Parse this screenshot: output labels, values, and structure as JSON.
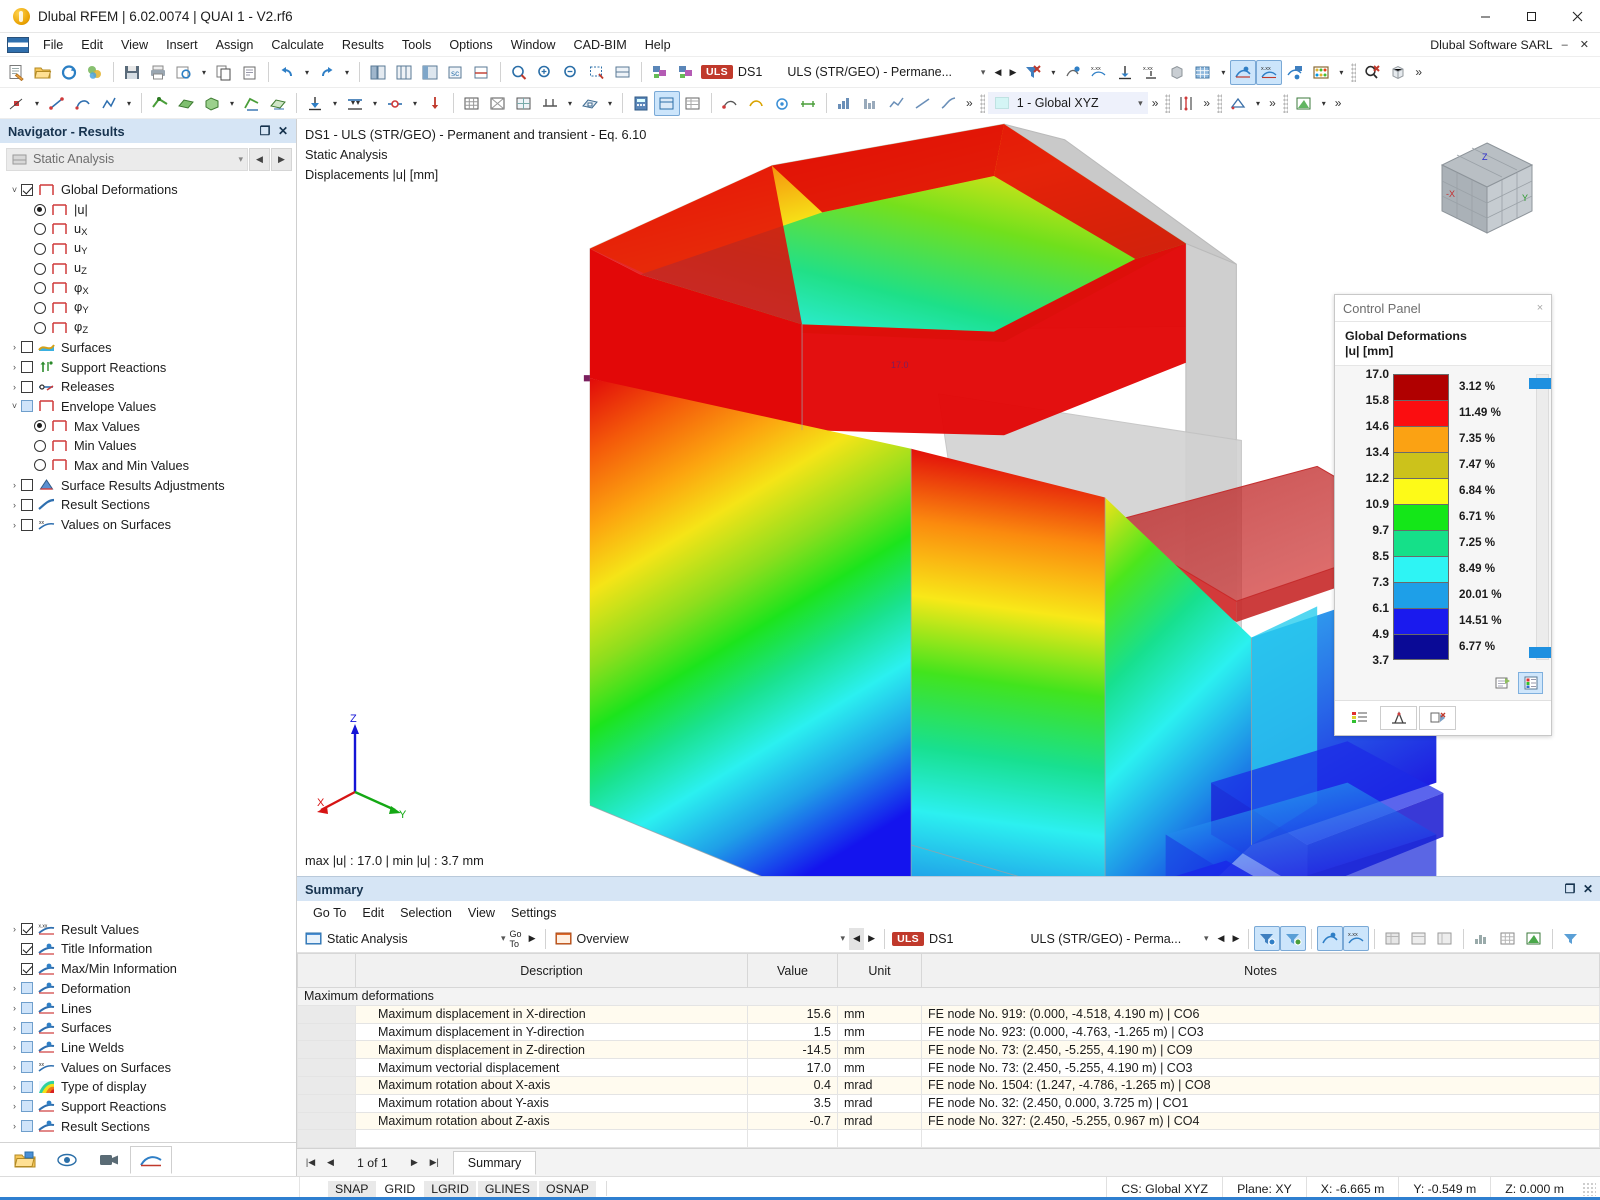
{
  "window": {
    "title": "Dlubal RFEM | 6.02.0074 | QUAI 1 - V2.rf6",
    "minimize": "–",
    "maximize": "□",
    "close": "✕",
    "vendor": "Dlubal Software SARL",
    "vendor_min": "–",
    "vendor_close": "✕"
  },
  "menubar": {
    "items": [
      "File",
      "Edit",
      "View",
      "Insert",
      "Assign",
      "Calculate",
      "Results",
      "Tools",
      "Options",
      "Window",
      "CAD-BIM",
      "Help"
    ]
  },
  "toolbar": {
    "uls_badge": "ULS",
    "design_situation": "DS1",
    "load_combination": "ULS (STR/GEO) - Permane...",
    "caret": "˅",
    "prev": "◀",
    "next": "▶",
    "overflow": "»",
    "coordinate_system": "1 - Global XYZ",
    "icons": [
      "new-file-icon",
      "open-file-icon",
      "save-icon",
      "save-all-icon",
      "print-icon",
      "print-preview-icon",
      "copy-icon",
      "paste-icon",
      "undo-icon",
      "redo-icon",
      "render-solid-icon",
      "render-wire-icon",
      "render-section-icon",
      "render-transparent-icon",
      "render-sections-icon",
      "zoom-window-icon",
      "zoom-all-icon",
      "zoom-previous-icon",
      "zoom-region-icon",
      "view-plane-icon",
      "load-case-prev-icon",
      "load-case-next-icon",
      "filter-clear-icon",
      "result-value-icon",
      "result-isoline-icon",
      "result-isoband-icon",
      "result-grid-icon",
      "result-surface-icon",
      "result-table-icon",
      "result-deformation-icon",
      "result-values-icon",
      "result-diagram-icon",
      "abacus-icon",
      "search-clear-icon",
      "cube-icon"
    ],
    "row2_icons": [
      "node-icon",
      "line-icon",
      "arc-icon",
      "polyline-icon",
      "member-icon",
      "surface-icon",
      "solid-icon",
      "support-icon",
      "nodal-support-icon",
      "line-support-icon",
      "hinge-icon",
      "load-icon",
      "load-case-icon",
      "imperfection-icon",
      "mesh-icon",
      "mesh-refine-icon",
      "fe-mesh-icon",
      "rib-icon",
      "opening-icon",
      "integrate-icon",
      "calculate-icon",
      "snap-icon",
      "grid-icon",
      "dimension-icon",
      "text-icon",
      "section-icon",
      "coord-icon",
      "render-icon",
      "table-icon"
    ]
  },
  "navigator": {
    "title": "Navigator - Results",
    "restore": "❐",
    "close": "✕",
    "analysis_selector": "Static Analysis",
    "prev": "◀",
    "next": "▶",
    "top_tree": [
      {
        "indent": 0,
        "expander": "˅",
        "control": "checkbox",
        "checked": true,
        "icon": "deformation-icon",
        "label": "Global Deformations"
      },
      {
        "indent": 1,
        "expander": "",
        "control": "radio",
        "checked": true,
        "icon": "deformation-icon",
        "label": "|u|"
      },
      {
        "indent": 1,
        "expander": "",
        "control": "radio",
        "checked": false,
        "icon": "deformation-icon",
        "label": "u",
        "sub": "X"
      },
      {
        "indent": 1,
        "expander": "",
        "control": "radio",
        "checked": false,
        "icon": "deformation-icon",
        "label": "u",
        "sub": "Y"
      },
      {
        "indent": 1,
        "expander": "",
        "control": "radio",
        "checked": false,
        "icon": "deformation-icon",
        "label": "u",
        "sub": "Z"
      },
      {
        "indent": 1,
        "expander": "",
        "control": "radio",
        "checked": false,
        "icon": "deformation-icon",
        "label": "φ",
        "sub": "X"
      },
      {
        "indent": 1,
        "expander": "",
        "control": "radio",
        "checked": false,
        "icon": "deformation-icon",
        "label": "φ",
        "sub": "Y"
      },
      {
        "indent": 1,
        "expander": "",
        "control": "radio",
        "checked": false,
        "icon": "deformation-icon",
        "label": "φ",
        "sub": "Z"
      },
      {
        "indent": 0,
        "expander": "›",
        "control": "checkbox",
        "checked": false,
        "icon": "surfaces-icon",
        "label": "Surfaces"
      },
      {
        "indent": 0,
        "expander": "›",
        "control": "checkbox",
        "checked": false,
        "icon": "support-reactions-icon",
        "label": "Support Reactions"
      },
      {
        "indent": 0,
        "expander": "›",
        "control": "checkbox",
        "checked": false,
        "icon": "releases-icon",
        "label": "Releases"
      },
      {
        "indent": 0,
        "expander": "˅",
        "control": "checkbox-partial",
        "checked": false,
        "icon": "envelope-icon",
        "label": "Envelope Values"
      },
      {
        "indent": 1,
        "expander": "",
        "control": "radio",
        "checked": true,
        "icon": "envelope-icon",
        "label": "Max Values"
      },
      {
        "indent": 1,
        "expander": "",
        "control": "radio",
        "checked": false,
        "icon": "envelope-icon",
        "label": "Min Values"
      },
      {
        "indent": 1,
        "expander": "",
        "control": "radio",
        "checked": false,
        "icon": "envelope-icon",
        "label": "Max and Min Values"
      },
      {
        "indent": 0,
        "expander": "›",
        "control": "checkbox",
        "checked": false,
        "icon": "surface-adjust-icon",
        "label": "Surface Results Adjustments"
      },
      {
        "indent": 0,
        "expander": "›",
        "control": "checkbox",
        "checked": false,
        "icon": "result-sections-icon",
        "label": "Result Sections"
      },
      {
        "indent": 0,
        "expander": "›",
        "control": "checkbox",
        "checked": false,
        "icon": "values-on-surfaces-icon",
        "label": "Values on Surfaces"
      }
    ],
    "bottom_tree": [
      {
        "indent": 0,
        "expander": "›",
        "control": "checkbox",
        "checked": true,
        "icon": "result-values-icon",
        "label": "Result Values"
      },
      {
        "indent": 0,
        "expander": "",
        "control": "checkbox",
        "checked": true,
        "icon": "title-info-icon",
        "label": "Title Information"
      },
      {
        "indent": 0,
        "expander": "",
        "control": "checkbox",
        "checked": true,
        "icon": "maxmin-info-icon",
        "label": "Max/Min Information"
      },
      {
        "indent": 0,
        "expander": "›",
        "control": "checkbox-partial",
        "checked": false,
        "icon": "deformation-display-icon",
        "label": "Deformation"
      },
      {
        "indent": 0,
        "expander": "›",
        "control": "checkbox-partial",
        "checked": false,
        "icon": "lines-display-icon",
        "label": "Lines"
      },
      {
        "indent": 0,
        "expander": "›",
        "control": "checkbox-partial",
        "checked": false,
        "icon": "surfaces-display-icon",
        "label": "Surfaces"
      },
      {
        "indent": 0,
        "expander": "›",
        "control": "checkbox-partial",
        "checked": false,
        "icon": "line-welds-icon",
        "label": "Line Welds"
      },
      {
        "indent": 0,
        "expander": "›",
        "control": "checkbox-partial",
        "checked": false,
        "icon": "values-on-surfaces-icon",
        "label": "Values on Surfaces"
      },
      {
        "indent": 0,
        "expander": "›",
        "control": "checkbox-partial",
        "checked": false,
        "icon": "type-of-display-icon",
        "label": "Type of display"
      },
      {
        "indent": 0,
        "expander": "›",
        "control": "checkbox-partial",
        "checked": false,
        "icon": "support-reactions-display-icon",
        "label": "Support Reactions"
      },
      {
        "indent": 0,
        "expander": "›",
        "control": "checkbox-partial",
        "checked": false,
        "icon": "result-sections-display-icon",
        "label": "Result Sections"
      }
    ],
    "footer_tabs": [
      "project-navigator-icon",
      "display-navigator-icon",
      "views-navigator-icon",
      "results-navigator-icon"
    ]
  },
  "viewport": {
    "title_line1": "DS1 - ULS (STR/GEO) - Permanent and transient - Eq. 6.10",
    "title_line2": "Static Analysis",
    "title_line3": "Displacements |u| [mm]",
    "minmax_text": "max |u| : 17.0 | min |u| : 3.7 mm",
    "max_marker_label": "17.0",
    "axis_x": "X",
    "axis_y": "Y",
    "axis_z": "Z",
    "cube_axis_x": "-X",
    "cube_axis_y": "Y",
    "cube_axis_z": "Z"
  },
  "control_panel": {
    "title": "Control Panel",
    "close": "×",
    "subtitle_line1": "Global Deformations",
    "subtitle_line2": "|u| [mm]",
    "legend_values": [
      "17.0",
      "15.8",
      "14.6",
      "13.4",
      "12.2",
      "10.9",
      "9.7",
      "8.5",
      "7.3",
      "6.1",
      "4.9",
      "3.7"
    ],
    "legend_percents": [
      "3.12 %",
      "11.49 %",
      "7.35 %",
      "7.47 %",
      "6.84 %",
      "6.71 %",
      "7.25 %",
      "8.49 %",
      "20.01 %",
      "14.51 %",
      "6.77 %"
    ],
    "legend_colors": [
      "#b00000",
      "#fb0d10",
      "#fba213",
      "#ccc21b",
      "#fdfa18",
      "#14e718",
      "#15e089",
      "#2ef4f4",
      "#1e9fe8",
      "#1a1aee",
      "#0a0a96"
    ],
    "slider_color": "#1e90e0",
    "tool_icons": [
      "legend-settings-icon",
      "legend-options-icon"
    ],
    "footer_icons": [
      "color-scale-icon",
      "factors-icon",
      "display-properties-icon"
    ]
  },
  "summary": {
    "title": "Summary",
    "restore": "❐",
    "close": "✕",
    "menu": [
      "Go To",
      "Edit",
      "Selection",
      "View",
      "Settings"
    ],
    "analysis_selector": "Static Analysis",
    "view_selector": "Overview",
    "uls_badge": "ULS",
    "design_situation": "DS1",
    "load_combination": "ULS (STR/GEO) - Perma...",
    "columns": [
      "",
      "Description",
      "Value",
      "Unit",
      "Notes"
    ],
    "group_row": "Maximum deformations",
    "rows": [
      {
        "description": "Maximum displacement in X-direction",
        "value": "15.6",
        "unit": "mm",
        "notes": "FE node No. 919: (0.000, -4.518, 4.190 m) | CO6"
      },
      {
        "description": "Maximum displacement in Y-direction",
        "value": "1.5",
        "unit": "mm",
        "notes": "FE node No. 923: (0.000, -4.763, -1.265 m) | CO3"
      },
      {
        "description": "Maximum displacement in Z-direction",
        "value": "-14.5",
        "unit": "mm",
        "notes": "FE node No. 73: (2.450, -5.255, 4.190 m) | CO9"
      },
      {
        "description": "Maximum vectorial displacement",
        "value": "17.0",
        "unit": "mm",
        "notes": "FE node No. 73: (2.450, -5.255, 4.190 m) | CO3"
      },
      {
        "description": "Maximum rotation about X-axis",
        "value": "0.4",
        "unit": "mrad",
        "notes": "FE node No. 1504: (1.247, -4.786, -1.265 m) | CO8"
      },
      {
        "description": "Maximum rotation about Y-axis",
        "value": "3.5",
        "unit": "mrad",
        "notes": "FE node No. 32: (2.450, 0.000, 3.725 m) | CO1"
      },
      {
        "description": "Maximum rotation about Z-axis",
        "value": "-0.7",
        "unit": "mrad",
        "notes": "FE node No. 327: (2.450, -5.255, 0.967 m) | CO4"
      }
    ],
    "page_first": "|◀",
    "page_prev": "◀",
    "page_label": "1 of 1",
    "page_next": "▶",
    "page_last": "▶|",
    "tab": "Summary"
  },
  "statusbar": {
    "toggles": [
      {
        "label": "SNAP",
        "active": true
      },
      {
        "label": "GRID",
        "active": false
      },
      {
        "label": "LGRID",
        "active": true
      },
      {
        "label": "GLINES",
        "active": true
      },
      {
        "label": "OSNAP",
        "active": true
      }
    ],
    "cs": "CS: Global XYZ",
    "plane": "Plane: XY",
    "x": "X: -6.665 m",
    "y": "Y: -0.549 m",
    "z": "Z: 0.000 m"
  }
}
